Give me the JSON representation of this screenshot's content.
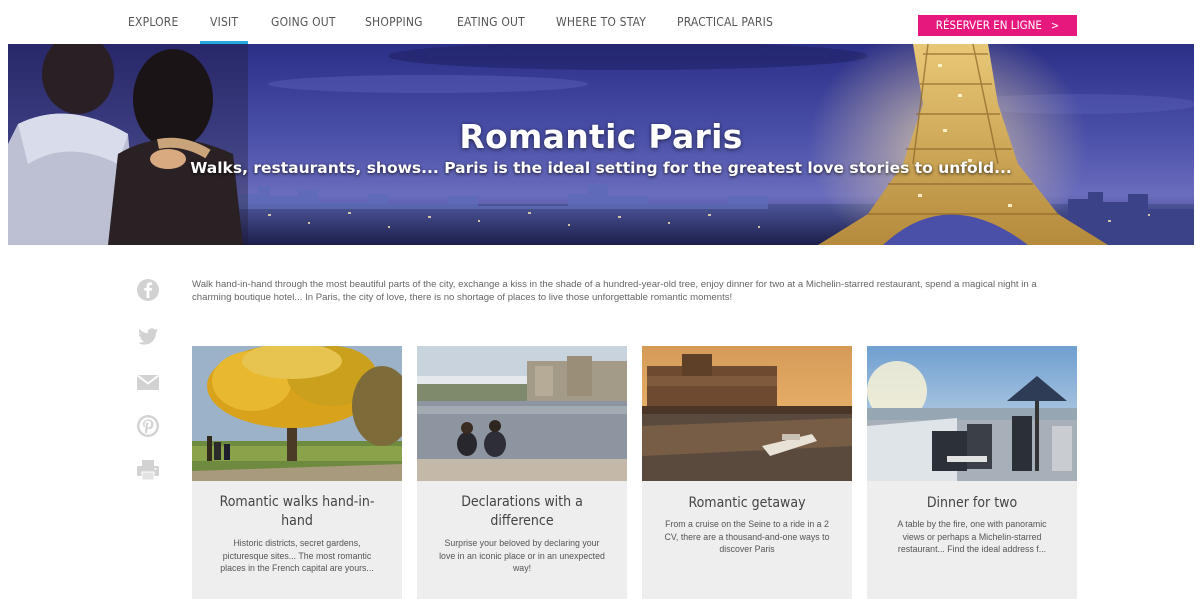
{
  "nav": {
    "items": [
      "EXPLORE",
      "VISIT",
      "GOING OUT",
      "SHOPPING",
      "EATING OUT",
      "WHERE TO STAY",
      "PRACTICAL PARIS"
    ],
    "active": "VISIT",
    "accent_color": "#25a9e0",
    "reserve": {
      "label": "RÉSERVER EN LIGNE",
      "color": "#e6187e"
    }
  },
  "hero": {
    "title": "Romantic Paris",
    "subtitle": "Walks, restaurants, shows... Paris is the ideal setting for the greatest love stories to unfold..."
  },
  "share": {
    "icons": [
      "facebook-icon",
      "twitter-icon",
      "email-icon",
      "pinterest-icon",
      "print-icon"
    ]
  },
  "intro": "Walk hand-in-hand through the most beautiful parts of the city, exchange a kiss in the shade of a hundred-year-old tree, enjoy dinner for two at a Michelin-starred restaurant, spend a magical night in a charming boutique hotel... In Paris, the city of love, there is no shortage of places to live those unforgettable romantic moments!",
  "cards": [
    {
      "title": "Romantic walks hand-in-hand",
      "text": "Historic districts, secret gardens, picturesque sites... The most romantic places in the French capital are yours..."
    },
    {
      "title": "Declarations with a difference",
      "text": "Surprise your beloved by declaring your love in an iconic place or in an unexpected way!"
    },
    {
      "title": "Romantic getaway",
      "text": "From a cruise on the Seine to a ride in a 2 CV, there are a thousand-and-one ways to discover Paris"
    },
    {
      "title": "Dinner for two",
      "text": "A table by the fire, one with panoramic views or perhaps a Michelin-starred restaurant... Find the ideal address f..."
    }
  ]
}
